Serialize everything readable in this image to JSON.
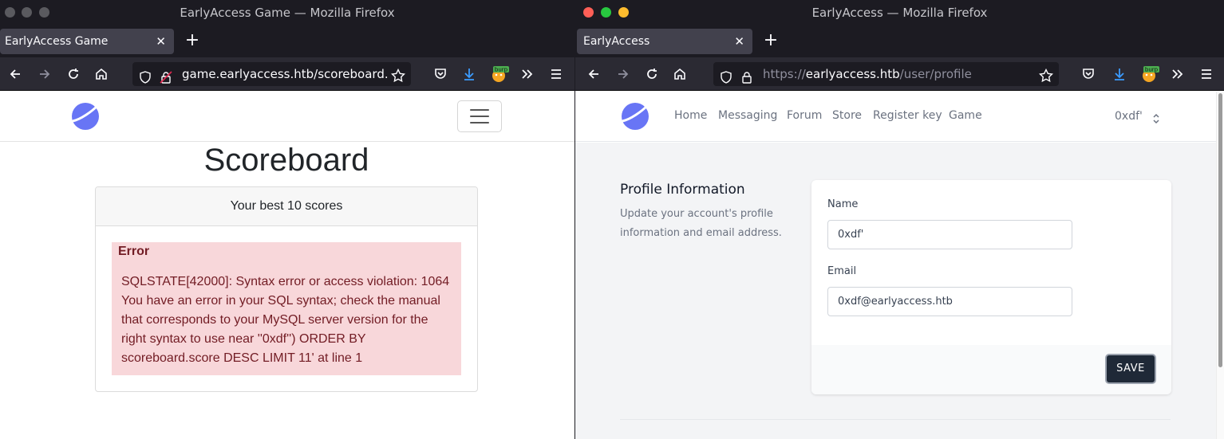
{
  "left_window": {
    "title": "EarlyAccess Game — Mozilla Firefox",
    "tab_label": "EarlyAccess Game",
    "url": "game.earlyaccess.htb/scoreboard.php",
    "page": {
      "heading": "Scoreboard",
      "card_header": "Your best 10 scores",
      "error_title": "Error",
      "error_message": "SQLSTATE[42000]: Syntax error or access violation: 1064 You have an error in your SQL syntax; check the manual that corresponds to your MySQL server version for the right syntax to use near ''0xdf'') ORDER BY scoreboard.score DESC LIMIT 11' at line 1"
    }
  },
  "right_window": {
    "title": "EarlyAccess — Mozilla Firefox",
    "tab_label": "EarlyAccess",
    "url_scheme": "https://",
    "url_host": "earlyaccess.htb",
    "url_path": "/user/profile",
    "nav": [
      "Home",
      "Messaging",
      "Forum",
      "Store",
      "Register key",
      "Game"
    ],
    "user_menu": "0xdf'",
    "profile": {
      "section_title": "Profile Information",
      "section_description": "Update your account's profile information and email address.",
      "name_label": "Name",
      "name_value": "0xdf'",
      "email_label": "Email",
      "email_value": "0xdf@earlyaccess.htb",
      "save_label": "SAVE"
    }
  },
  "extension_badge": "burp",
  "colors": {
    "chrome_dark": "#1c1b22",
    "toolbar": "#2b2a33",
    "download_icon": "#3b9cff",
    "logo": "#6875f5",
    "error_bg": "#f8d7da",
    "error_text": "#721c24",
    "save_button": "#1f2937"
  }
}
